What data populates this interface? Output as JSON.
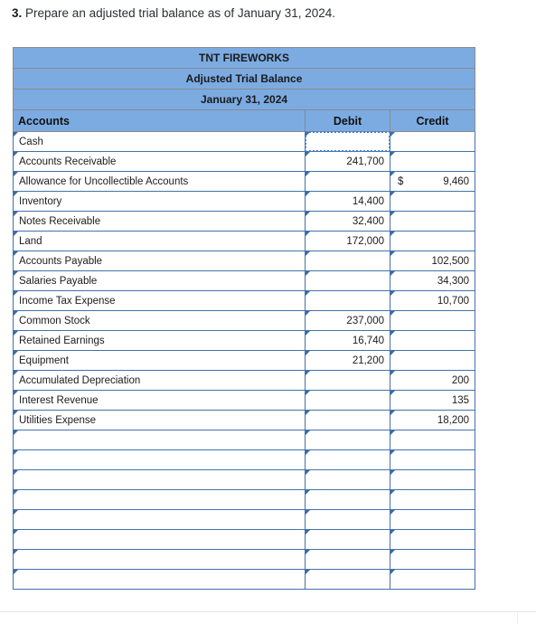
{
  "prompt": {
    "number": "3.",
    "text": "Prepare an adjusted trial balance as of January 31, 2024."
  },
  "worksheet": {
    "title_lines": [
      "TNT FIREWORKS",
      "Adjusted Trial Balance",
      "January 31, 2024"
    ],
    "columns": {
      "accounts": "Accounts",
      "debit": "Debit",
      "credit": "Credit"
    },
    "currency_symbol": "$",
    "colors": {
      "header_fill": "#7cabe2",
      "cell_border": "#4472a8",
      "header_border": "#8a8a8a",
      "selection_border": "#3f7fd0",
      "marker": "#3a6ba5"
    },
    "selected_cell": "Cash Debit",
    "rows": [
      {
        "account": "Cash",
        "debit": "",
        "credit": "",
        "debit_currency": "",
        "credit_currency": "",
        "selected": "debit"
      },
      {
        "account": "Accounts Receivable",
        "debit": "241,700",
        "credit": "",
        "debit_currency": "",
        "credit_currency": ""
      },
      {
        "account": "Allowance for Uncollectible Accounts",
        "debit": "",
        "credit": "9,460",
        "debit_currency": "",
        "credit_currency": "$"
      },
      {
        "account": "Inventory",
        "debit": "14,400",
        "credit": "",
        "debit_currency": "",
        "credit_currency": ""
      },
      {
        "account": "Notes Receivable",
        "debit": "32,400",
        "credit": "",
        "debit_currency": "",
        "credit_currency": ""
      },
      {
        "account": "Land",
        "debit": "172,000",
        "credit": "",
        "debit_currency": "",
        "credit_currency": ""
      },
      {
        "account": "Accounts Payable",
        "debit": "",
        "credit": "102,500",
        "debit_currency": "",
        "credit_currency": ""
      },
      {
        "account": "Salaries Payable",
        "debit": "",
        "credit": "34,300",
        "debit_currency": "",
        "credit_currency": ""
      },
      {
        "account": "Income Tax Expense",
        "debit": "",
        "credit": "10,700",
        "debit_currency": "",
        "credit_currency": ""
      },
      {
        "account": "Common Stock",
        "debit": "237,000",
        "credit": "",
        "debit_currency": "",
        "credit_currency": ""
      },
      {
        "account": "Retained Earnings",
        "debit": "16,740",
        "credit": "",
        "debit_currency": "",
        "credit_currency": ""
      },
      {
        "account": "Equipment",
        "debit": "21,200",
        "credit": "",
        "debit_currency": "",
        "credit_currency": ""
      },
      {
        "account": "Accumulated Depreciation",
        "debit": "",
        "credit": "200",
        "debit_currency": "",
        "credit_currency": ""
      },
      {
        "account": "Interest Revenue",
        "debit": "",
        "credit": "135",
        "debit_currency": "",
        "credit_currency": ""
      },
      {
        "account": "Utilities Expense",
        "debit": "",
        "credit": "18,200",
        "debit_currency": "",
        "credit_currency": ""
      },
      {
        "account": "",
        "debit": "",
        "credit": "",
        "debit_currency": "",
        "credit_currency": ""
      },
      {
        "account": "",
        "debit": "",
        "credit": "",
        "debit_currency": "",
        "credit_currency": ""
      },
      {
        "account": "",
        "debit": "",
        "credit": "",
        "debit_currency": "",
        "credit_currency": ""
      },
      {
        "account": "",
        "debit": "",
        "credit": "",
        "debit_currency": "",
        "credit_currency": ""
      },
      {
        "account": "",
        "debit": "",
        "credit": "",
        "debit_currency": "",
        "credit_currency": ""
      },
      {
        "account": "",
        "debit": "",
        "credit": "",
        "debit_currency": "",
        "credit_currency": ""
      },
      {
        "account": "",
        "debit": "",
        "credit": "",
        "debit_currency": "",
        "credit_currency": ""
      },
      {
        "account": "",
        "debit": "",
        "credit": "",
        "debit_currency": "",
        "credit_currency": ""
      }
    ]
  }
}
